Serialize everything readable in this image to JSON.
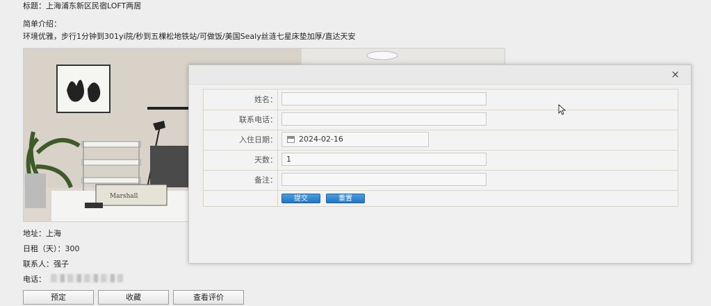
{
  "listing": {
    "title_line": "标题：上海浦东新区民宿LOFT两居",
    "intro_heading": "简单介绍：",
    "intro_text": "环境优雅，步行1分钟到301yi院/秒到五棵松地铁站/可做饭/美国Sealy丝涟七星床垫加厚/直达天安",
    "address": "地址：上海",
    "daily_rent": "日租（天）：300",
    "contact": "联系人：强子",
    "phone_label": "电话："
  },
  "actions": {
    "book": "预定",
    "favorite": "收藏",
    "reviews": "查看评价"
  },
  "modal": {
    "close": "×",
    "fields": {
      "name_label": "姓名：",
      "name_value": "",
      "phone_label": "联系电话：",
      "phone_value": "",
      "date_label": "入住日期：",
      "date_value": "2024-02-16",
      "days_label": "天数：",
      "days_value": "1",
      "remark_label": "备注：",
      "remark_value": ""
    },
    "submit": "提交",
    "reset": "重置"
  },
  "photo": {
    "speaker_brand": "Marshall"
  }
}
